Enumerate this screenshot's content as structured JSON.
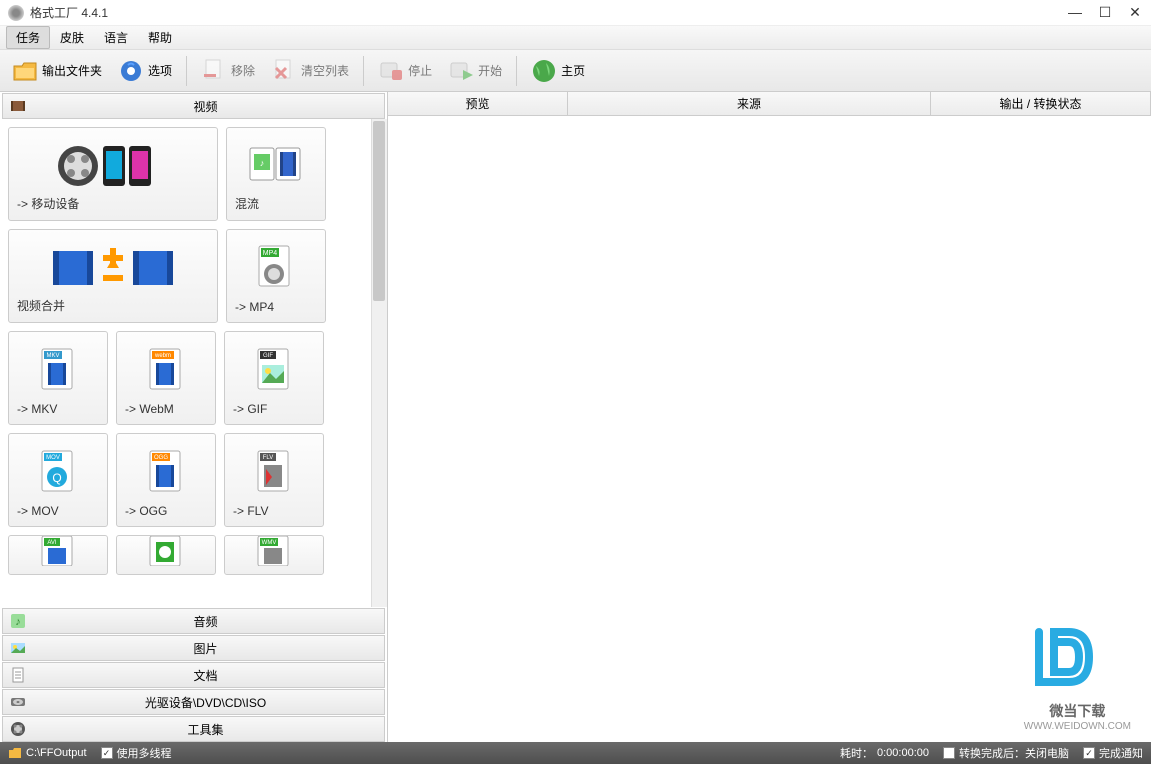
{
  "window": {
    "title": "格式工厂 4.4.1"
  },
  "menu": {
    "task": "任务",
    "skin": "皮肤",
    "language": "语言",
    "help": "帮助"
  },
  "toolbar": {
    "output_folder": "输出文件夹",
    "options": "选项",
    "remove": "移除",
    "clear_list": "清空列表",
    "stop": "停止",
    "start": "开始",
    "home": "主页"
  },
  "categories": {
    "video": "视频",
    "audio": "音频",
    "image": "图片",
    "document": "文档",
    "rom": "光驱设备\\DVD\\CD\\ISO",
    "tools": "工具集"
  },
  "tiles": {
    "mobile": "-> 移动设备",
    "mux": "混流",
    "videojoin": "视频合并",
    "mp4": "-> MP4",
    "mkv": "-> MKV",
    "webm": "-> WebM",
    "gif": "-> GIF",
    "mov": "-> MOV",
    "ogg": "-> OGG",
    "flv": "-> FLV",
    "avi_tag": "AVI",
    "wmv_tag": "WMV"
  },
  "columns": {
    "preview": "预览",
    "source": "来源",
    "output": "输出 / 转换状态"
  },
  "status": {
    "output_path": "C:\\FFOutput",
    "multithread": "使用多线程",
    "elapsed_label": "耗时：",
    "elapsed_value": "0:00:00:00",
    "shutdown": "转换完成后：关闭电脑",
    "notify": "完成通知"
  },
  "watermark": {
    "title": "微当下载",
    "url": "WWW.WEIDOWN.COM"
  }
}
